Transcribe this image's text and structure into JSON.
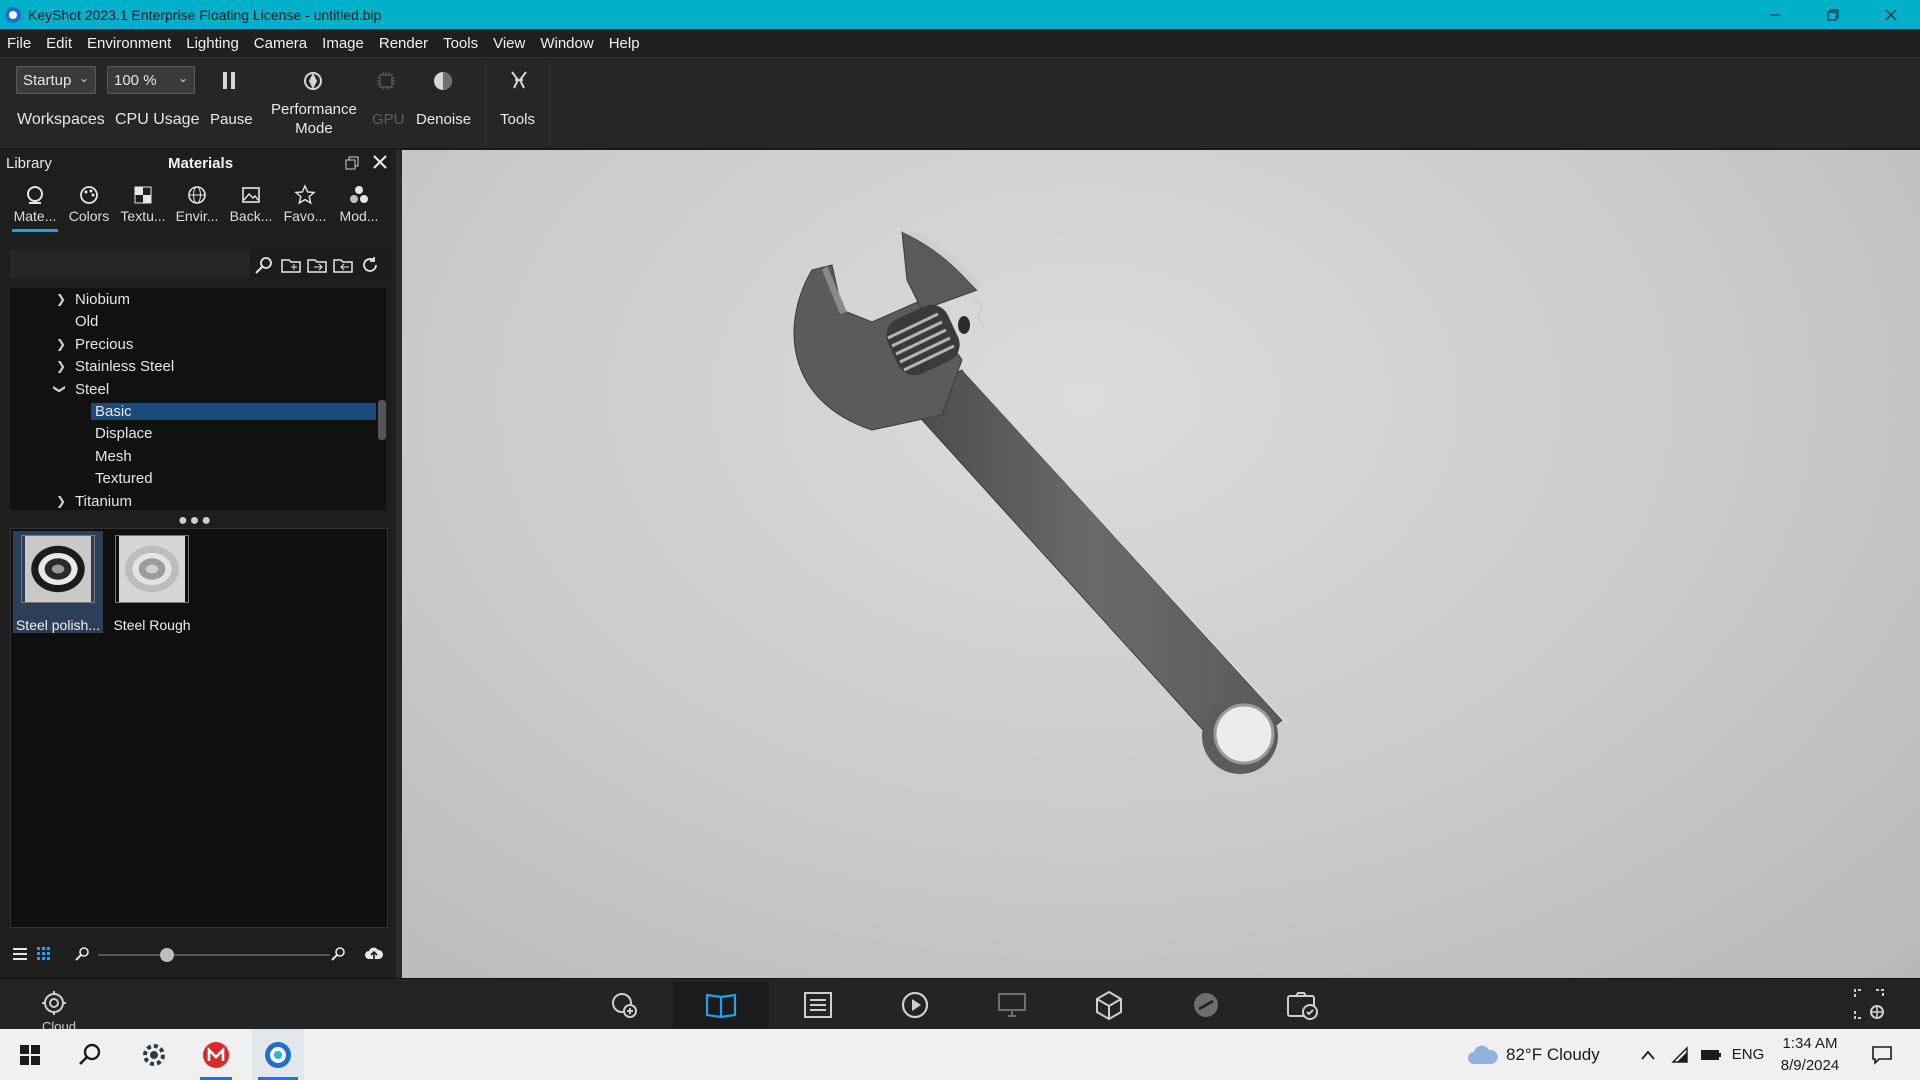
{
  "window": {
    "title": "KeyShot 2023.1 Enterprise Floating License  - untitled.bip"
  },
  "menu": [
    "File",
    "Edit",
    "Environment",
    "Lighting",
    "Camera",
    "Image",
    "Render",
    "Tools",
    "View",
    "Window",
    "Help"
  ],
  "toolbar": {
    "workspace_value": "Startup",
    "workspace_label": "Workspaces",
    "cpu_value": "100 %",
    "cpu_label": "CPU Usage",
    "pause_label": "Pause",
    "performance_label_1": "Performance",
    "performance_label_2": "Mode",
    "gpu_label": "GPU",
    "denoise_label": "Denoise",
    "tools_label": "Tools"
  },
  "library": {
    "header_left": "Library",
    "header_title": "Materials",
    "tabs": [
      "Mate...",
      "Colors",
      "Textu...",
      "Envir...",
      "Back...",
      "Favo...",
      "Mod..."
    ],
    "tree": [
      "Niobium",
      "Old",
      "Precious",
      "Stainless Steel",
      "Steel",
      "Basic",
      "Displace",
      "Mesh",
      "Textured",
      "Titanium"
    ],
    "thumbnails": [
      "Steel polish...",
      "Steel Rough"
    ]
  },
  "taskbar": {
    "weather": "82°F  Cloudy",
    "lang": "ENG",
    "time": "1:34 AM",
    "date": "8/9/2024",
    "cloud_label": "Cloud"
  },
  "colors": {
    "titlebar": "#00b0c8",
    "selection": "#1b4a7e",
    "accent": "#1da1f2"
  }
}
